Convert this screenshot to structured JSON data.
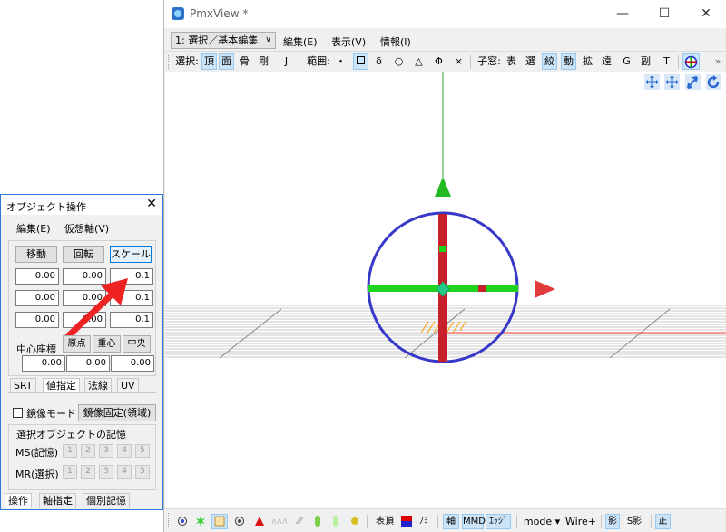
{
  "main_window": {
    "title": "PmxView *",
    "controls": {
      "minimize": "—",
      "maximize": "☐",
      "close": "✕"
    },
    "mode_select": "1: 選択／基本編集",
    "menu": [
      "編集(E)",
      "表示(V)",
      "情報(I)"
    ]
  },
  "toolbar": {
    "select_label": "選択:",
    "select_items": [
      "頂",
      "面",
      "骨",
      "剛",
      "J"
    ],
    "range_label": "範囲:",
    "range_items": [
      "・",
      "δ",
      "○",
      "△",
      "Φ",
      "×"
    ],
    "child_label": "子窓:",
    "child_items": [
      "表",
      "選",
      "絞",
      "動",
      "拡",
      "遠",
      "G",
      "副",
      "T"
    ],
    "overflow": "»"
  },
  "statusbar": {
    "items": [
      "表頂",
      "ﾉﾐ",
      "軸",
      "MMD",
      "ｴｯｼﾞ",
      "mode ▾",
      "Wire+",
      "影",
      "S影",
      "正"
    ]
  },
  "panel": {
    "title": "オブジェクト操作",
    "close": "✕",
    "menu": [
      "編集(E)",
      "仮想軸(V)"
    ],
    "buttons": {
      "move": "移動",
      "rotate": "回転",
      "scale": "スケール"
    },
    "rows": [
      [
        "0.00",
        "0.00",
        "0.1"
      ],
      [
        "0.00",
        "0.00",
        "0.1"
      ],
      [
        "0.00",
        "0.00",
        "0.1"
      ]
    ],
    "center_label": "中心座標",
    "center_buttons": [
      "原点",
      "重心",
      "中央"
    ],
    "center_values": [
      "0.00",
      "0.00",
      "0.00"
    ],
    "tabs": [
      "SRT",
      "値指定",
      "法線",
      "UV"
    ],
    "mirror_label": "鏡像モード",
    "mirror_fixed": "鏡像固定(領域)",
    "memory_label": "選択オブジェクトの記憶",
    "ms_label": "MS(記憶)",
    "mr_label": "MR(選択)",
    "memory_slots": [
      "1",
      "2",
      "3",
      "4",
      "5"
    ],
    "bottom_tabs": [
      "操作",
      "軸指定",
      "個別記憶"
    ]
  },
  "colors": {
    "accent": "#2b79d8",
    "green_axis": "#00c800",
    "red_axis": "#c80000",
    "blue_circle": "#3838c8",
    "arrow_red": "#ee2222"
  }
}
